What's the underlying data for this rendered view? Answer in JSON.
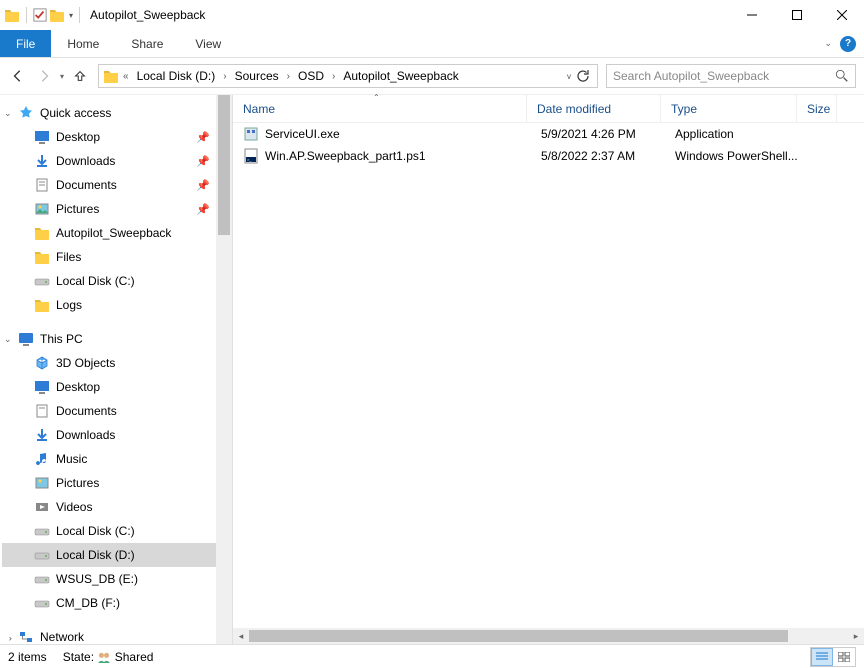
{
  "window": {
    "title": "Autopilot_Sweepback"
  },
  "ribbon": {
    "file": "File",
    "tabs": [
      "Home",
      "Share",
      "View"
    ]
  },
  "breadcrumbs": [
    "Local Disk (D:)",
    "Sources",
    "OSD",
    "Autopilot_Sweepback"
  ],
  "search": {
    "placeholder": "Search Autopilot_Sweepback"
  },
  "tree": {
    "quick_access": {
      "label": "Quick access"
    },
    "qa_items": [
      {
        "label": "Desktop",
        "pinned": true
      },
      {
        "label": "Downloads",
        "pinned": true
      },
      {
        "label": "Documents",
        "pinned": true
      },
      {
        "label": "Pictures",
        "pinned": true
      },
      {
        "label": "Autopilot_Sweepback",
        "pinned": false
      },
      {
        "label": "Files",
        "pinned": false
      },
      {
        "label": "Local Disk (C:)",
        "pinned": false
      },
      {
        "label": "Logs",
        "pinned": false
      }
    ],
    "this_pc": {
      "label": "This PC"
    },
    "pc_items": [
      {
        "label": "3D Objects"
      },
      {
        "label": "Desktop"
      },
      {
        "label": "Documents"
      },
      {
        "label": "Downloads"
      },
      {
        "label": "Music"
      },
      {
        "label": "Pictures"
      },
      {
        "label": "Videos"
      },
      {
        "label": "Local Disk (C:)"
      },
      {
        "label": "Local Disk (D:)",
        "selected": true
      },
      {
        "label": "WSUS_DB (E:)"
      },
      {
        "label": "CM_DB (F:)"
      }
    ],
    "network": {
      "label": "Network"
    }
  },
  "columns": {
    "name": "Name",
    "date": "Date modified",
    "type": "Type",
    "size": "Size"
  },
  "files": [
    {
      "name": "ServiceUI.exe",
      "date": "5/9/2021 4:26 PM",
      "type": "Application"
    },
    {
      "name": "Win.AP.Sweepback_part1.ps1",
      "date": "5/8/2022 2:37 AM",
      "type": "Windows PowerShell..."
    }
  ],
  "status": {
    "items": "2 items",
    "state_label": "State:",
    "state_value": "Shared"
  }
}
